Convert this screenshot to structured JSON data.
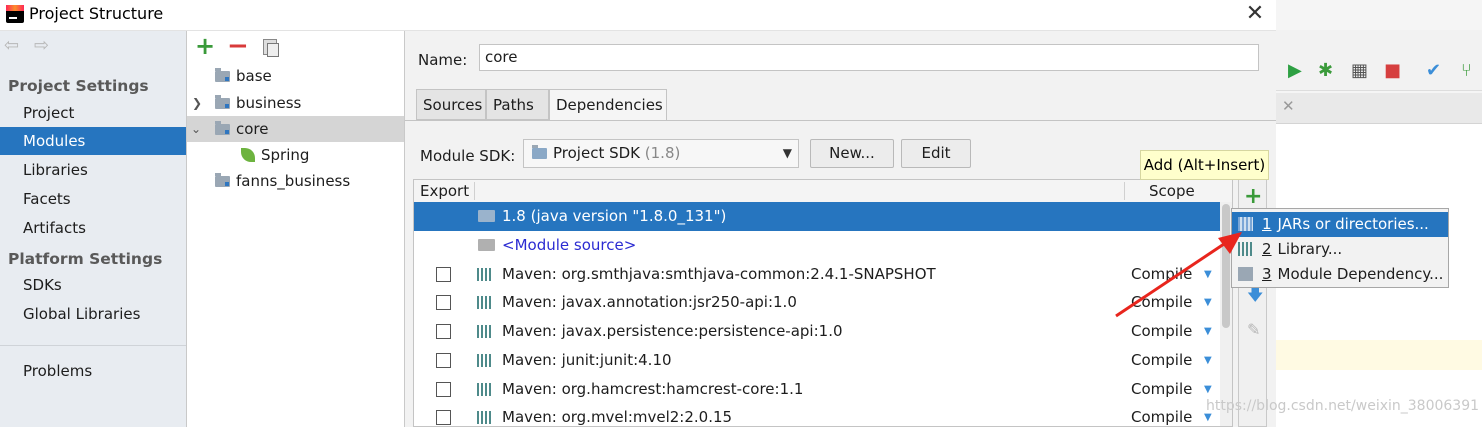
{
  "window": {
    "title": "Project Structure",
    "close_glyph": "✕"
  },
  "nav": {
    "back_glyph": "⇦",
    "forward_glyph": "⇨",
    "project_settings_header": "Project Settings",
    "project_settings_items": [
      "Project",
      "Modules",
      "Libraries",
      "Facets",
      "Artifacts"
    ],
    "platform_settings_header": "Platform Settings",
    "platform_settings_items": [
      "SDKs",
      "Global Libraries"
    ],
    "problems": "Problems",
    "selected": "Modules"
  },
  "tree": {
    "toolbar": {
      "add": "+",
      "remove": "−"
    },
    "items": [
      {
        "label": "base"
      },
      {
        "label": "business"
      },
      {
        "label": "core"
      },
      {
        "label": "Spring"
      },
      {
        "label": "fanns_business"
      }
    ],
    "selected": "core"
  },
  "module": {
    "name_label": "Name:",
    "name_value": "core",
    "tabs": [
      "Sources",
      "Paths",
      "Dependencies"
    ],
    "active_tab": "Dependencies",
    "sdk_label": "Module SDK:",
    "sdk_value": "Project SDK",
    "sdk_version": "(1.8)",
    "new_button": "New...",
    "edit_button": "Edit"
  },
  "dependencies": {
    "headers": {
      "export": "Export",
      "scope": "Scope"
    },
    "rows": [
      {
        "text": "1.8 (java version \"1.8.0_131\")",
        "scope": ""
      },
      {
        "text": "<Module source>",
        "scope": ""
      },
      {
        "text": "Maven: org.smthjava:smthjava-common:2.4.1-SNAPSHOT",
        "scope": "Compile"
      },
      {
        "text": "Maven: javax.annotation:jsr250-api:1.0",
        "scope": "Compile"
      },
      {
        "text": "Maven: javax.persistence:persistence-api:1.0",
        "scope": "Compile"
      },
      {
        "text": "Maven: junit:junit:4.10",
        "scope": "Compile"
      },
      {
        "text": "Maven: org.hamcrest:hamcrest-core:1.1",
        "scope": "Compile"
      },
      {
        "text": "Maven: org.mvel:mvel2:2.0.15",
        "scope": "Compile"
      }
    ]
  },
  "side_toolbar": {
    "add": "+",
    "move_down": "🡇",
    "edit": "✎"
  },
  "tooltip": "Add (Alt+Insert)",
  "popup": {
    "items": [
      {
        "mnemonic": "1",
        "label": "JARs or directories..."
      },
      {
        "mnemonic": "2",
        "label": "Library..."
      },
      {
        "mnemonic": "3",
        "label": "Module Dependency..."
      }
    ],
    "selected_index": 0
  },
  "watermark": "https://blog.csdn.net/weixin_38006391",
  "colors": {
    "selection": "#2675bf",
    "annotation_arrow": "#e8251d"
  }
}
